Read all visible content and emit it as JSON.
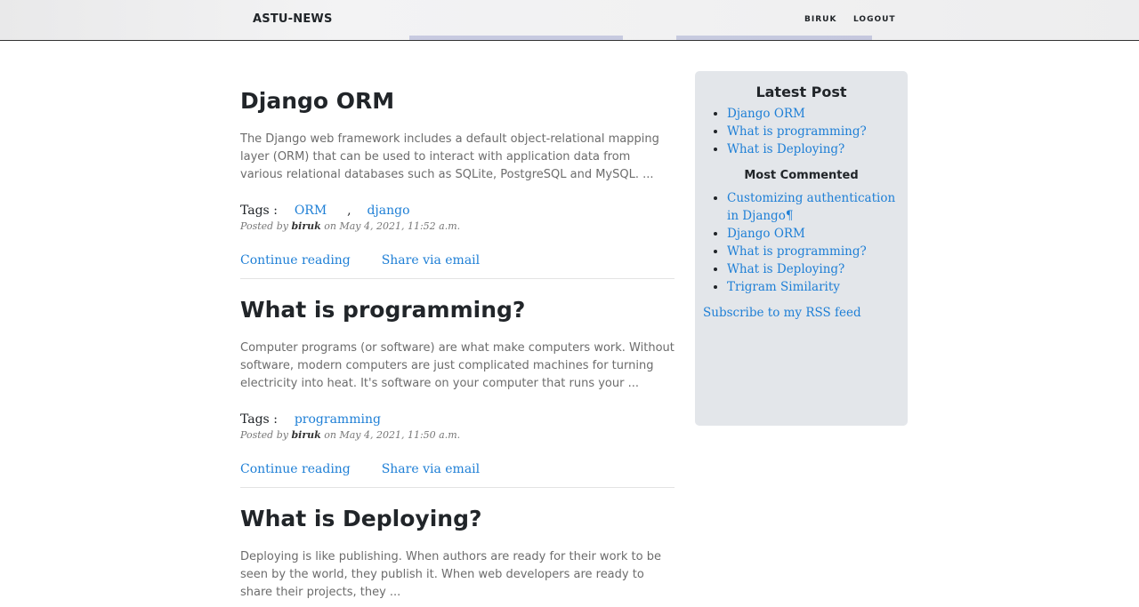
{
  "nav": {
    "brand": "ASTU-NEWS",
    "user": "BIRUK",
    "logout": "LOGOUT"
  },
  "posts": [
    {
      "title": "Django ORM",
      "excerpt": "The Django web framework includes a default object-relational mapping layer (ORM) that can be used to interact with application data from various relational databases such as SQLite, PostgreSQL and MySQL. ...",
      "tags_label": "Tags :",
      "tags": [
        "ORM",
        "django"
      ],
      "tag_separator": ",",
      "posted_by": "Posted by",
      "author": "biruk",
      "on": "on",
      "date": "May 4, 2021, 11:52 a.m.",
      "continue": "Continue reading",
      "share": "Share via email"
    },
    {
      "title": "What is programming?",
      "excerpt": "Computer programs (or software) are what make computers work. Without software, modern computers are just complicated machines for turning electricity into heat. It's software on your computer that runs your ...",
      "tags_label": "Tags :",
      "tags": [
        "programming"
      ],
      "posted_by": "Posted by",
      "author": "biruk",
      "on": "on",
      "date": "May 4, 2021, 11:50 a.m.",
      "continue": "Continue reading",
      "share": "Share via email"
    },
    {
      "title": "What is Deploying?",
      "excerpt": "Deploying is like publishing. When authors are ready for their work to be seen by the world, they publish it. When web developers are ready to share their projects, they ..."
    }
  ],
  "sidebar": {
    "latest_title": "Latest Post",
    "latest": [
      "Django ORM",
      "What is programming?",
      "What is Deploying?"
    ],
    "commented_title": "Most Commented",
    "commented": [
      "Customizing authentication in Django¶",
      "Django ORM",
      "What is programming?",
      "What is Deploying?",
      "Trigram Similarity"
    ],
    "rss": "Subscribe to my RSS feed"
  }
}
